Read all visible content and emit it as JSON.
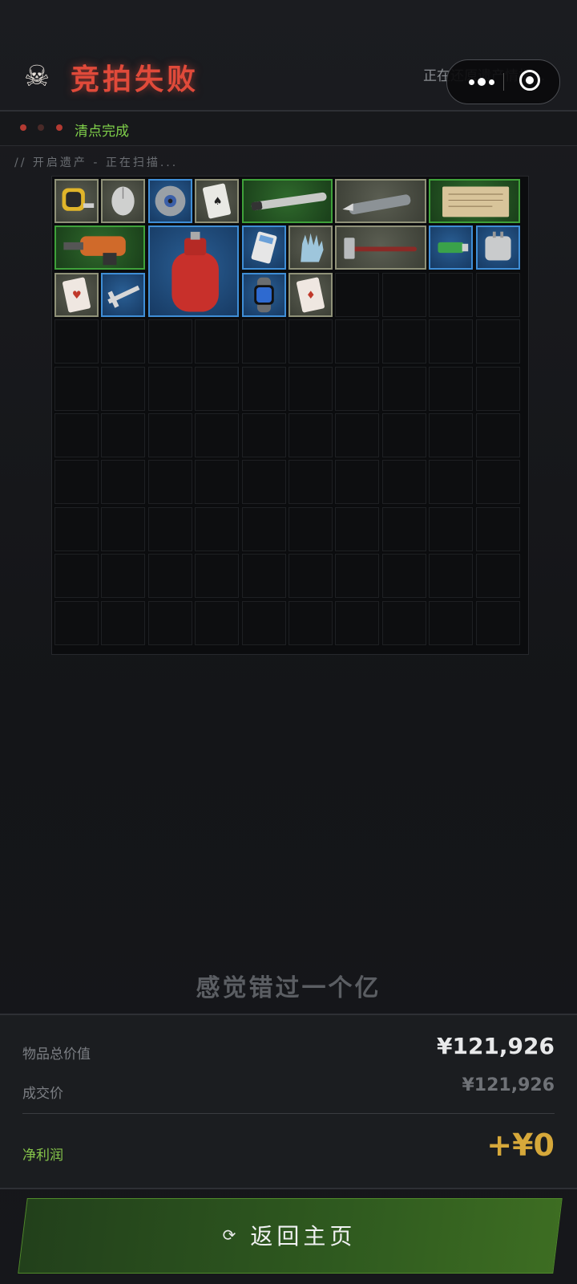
{
  "header": {
    "title": "竞拍失败",
    "skull_icon": "☠",
    "restoring_text": "正在还原遗产情报..."
  },
  "status": {
    "label": "清点完成"
  },
  "scan": {
    "text": "// 开启遗产 - 正在扫描..."
  },
  "grid": {
    "columns": 10,
    "rows": 10,
    "items": [
      {
        "name": "tape-measure",
        "rarity": "gray",
        "col": 0,
        "row": 0,
        "w": 1,
        "h": 1
      },
      {
        "name": "computer-mouse",
        "rarity": "gray",
        "col": 1,
        "row": 0,
        "w": 1,
        "h": 1
      },
      {
        "name": "cutting-disc",
        "rarity": "blue",
        "col": 2,
        "row": 0,
        "w": 1,
        "h": 1
      },
      {
        "name": "playing-card-spades",
        "rarity": "gray",
        "col": 3,
        "row": 0,
        "w": 1,
        "h": 1
      },
      {
        "name": "cylinder-rod",
        "rarity": "green",
        "col": 4,
        "row": 0,
        "w": 2,
        "h": 1
      },
      {
        "name": "utility-knife",
        "rarity": "gray",
        "col": 6,
        "row": 0,
        "w": 2,
        "h": 1
      },
      {
        "name": "old-document",
        "rarity": "green",
        "col": 8,
        "row": 0,
        "w": 2,
        "h": 1
      },
      {
        "name": "power-drill",
        "rarity": "green",
        "col": 0,
        "row": 1,
        "w": 2,
        "h": 1
      },
      {
        "name": "gas-cylinder",
        "rarity": "blue",
        "col": 2,
        "row": 1,
        "w": 2,
        "h": 2
      },
      {
        "name": "calculator",
        "rarity": "blue",
        "col": 4,
        "row": 1,
        "w": 1,
        "h": 1
      },
      {
        "name": "rubber-glove",
        "rarity": "gray",
        "col": 5,
        "row": 1,
        "w": 1,
        "h": 1
      },
      {
        "name": "hammer",
        "rarity": "gray",
        "col": 6,
        "row": 1,
        "w": 2,
        "h": 1
      },
      {
        "name": "usb-drive",
        "rarity": "blue",
        "col": 8,
        "row": 1,
        "w": 1,
        "h": 1
      },
      {
        "name": "travel-adapter",
        "rarity": "blue",
        "col": 9,
        "row": 1,
        "w": 1,
        "h": 1
      },
      {
        "name": "playing-card-hearts",
        "rarity": "gray",
        "col": 0,
        "row": 2,
        "w": 1,
        "h": 1
      },
      {
        "name": "vernier-caliper",
        "rarity": "blue",
        "col": 1,
        "row": 2,
        "w": 1,
        "h": 1
      },
      {
        "name": "smart-watch",
        "rarity": "blue",
        "col": 4,
        "row": 2,
        "w": 1,
        "h": 1
      },
      {
        "name": "playing-card-diamonds",
        "rarity": "gray",
        "col": 5,
        "row": 2,
        "w": 1,
        "h": 1
      }
    ]
  },
  "result": {
    "slogan": "感觉错过一个亿",
    "total_value_label": "物品总价值",
    "total_value": "¥121,926",
    "deal_price_label": "成交价",
    "deal_price": "¥121,926",
    "profit_label": "净利润",
    "profit": "+¥0"
  },
  "button": {
    "label": "返回主页",
    "icon": "⟳"
  },
  "colors": {
    "title_red": "#e04a3a",
    "status_green": "#7fcf4a",
    "profit_gold": "#d6a83a",
    "rarity_gray": "#8f9178",
    "rarity_blue": "#3f8ed6",
    "rarity_green": "#3fa13a"
  }
}
